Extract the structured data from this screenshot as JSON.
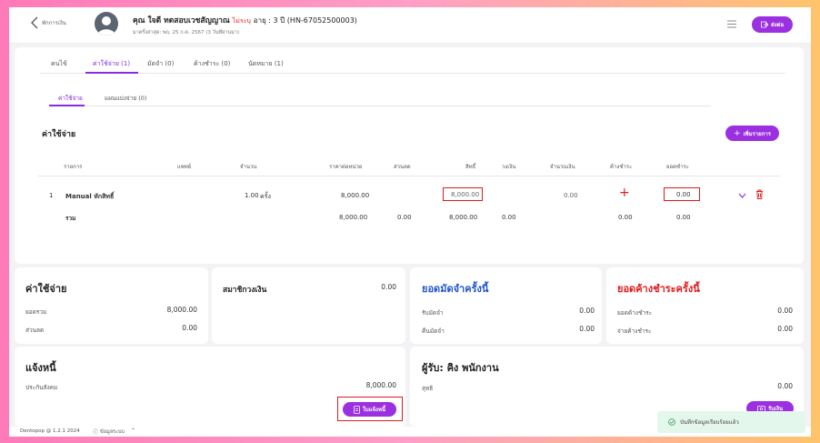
{
  "header": {
    "back_label": "พักการเงิน",
    "patient_name": "คุณ ใจดี ทดสอบเวชสัญญาณ",
    "patient_tag": "ไม่ระบุ",
    "age_text": "อายุ : 3 ปี (HN-67052500003)",
    "last_visit": "มาครั้งล่าสุด: พฤ. 25 ก.ค. 2567 (3 วันที่ผ่านมา)",
    "send_button": "ส่งต่อ"
  },
  "main_tabs": [
    {
      "label": "คนไข้"
    },
    {
      "label": "ค่าใช้จ่าย (1)"
    },
    {
      "label": "มัดจำ (0)"
    },
    {
      "label": "ค้างชำระ (0)"
    },
    {
      "label": "นัดหมาย (1)"
    }
  ],
  "sub_tabs": [
    {
      "label": "ค่าใช้จ่าย"
    },
    {
      "label": "แผนแบ่งจ่าย (0)"
    }
  ],
  "expense": {
    "title": "ค่าใช้จ่าย",
    "add_button": "เพิ่มรายการ",
    "columns": [
      "รายการ",
      "แพทย์",
      "จำนวน",
      "ราคาต่อหน่วย",
      "ส่วนลด",
      "สิทธิ์",
      "วงเงิน",
      "จำนวนเงิน",
      "ค้างชำระ",
      "ยอดชำระ"
    ],
    "row": {
      "index": "1",
      "item": "Manual หักสิทธิ์",
      "qty": "1.00",
      "unit": "ครั้ง",
      "unit_price": "8,000.00",
      "privilege": "8,000.00",
      "amount": "0.00",
      "paid": "0.00"
    },
    "total": {
      "label": "รวม",
      "unit_price": "8,000.00",
      "discount": "0.00",
      "privilege": "8,000.00",
      "limit": "0.00",
      "outstanding": "0.00",
      "paid": "0.00"
    }
  },
  "summary": {
    "expense_title": "ค่าใช้จ่าย",
    "total_label": "ยอดรวม",
    "total_value": "8,000.00",
    "discount_label": "ส่วนลด",
    "discount_value": "0.00",
    "member_title": "สมาชิกวงเงิน",
    "member_value": "0.00",
    "deposit_title": "ยอดมัดจำครั้งนี้",
    "deposit_receive_label": "รับมัดจำ",
    "deposit_receive_value": "0.00",
    "deposit_return_label": "คืนมัดจำ",
    "deposit_return_value": "0.00",
    "outstanding_title": "ยอดค้างชำระครั้งนี้",
    "outstanding_label": "ยอดค้างชำระ",
    "outstanding_value": "0.00",
    "pay_outstanding_label": "จ่ายค้างชำระ",
    "pay_outstanding_value": "0.00"
  },
  "notify": {
    "title": "แจ้งหนี้",
    "claim_label": "ประกันสังคม",
    "claim_value": "8,000.00",
    "invoice_button": "ใบแจ้งหนี้"
  },
  "receiver": {
    "title": "ผู้รับ: คิง พนักงาน",
    "net_label": "สุทธิ",
    "net_value": "0.00",
    "receive_button": "รับเงิน"
  },
  "footer": {
    "version": "Dentopop @ 1.2.1 2024",
    "system_info": "ข้อมูลระบบ"
  },
  "toast": {
    "message": "บันทึกข้อมูลเรียบร้อยแล้ว"
  },
  "colors": {
    "accent": "#9b30e0",
    "danger": "#e01a1a",
    "info": "#2255cc"
  }
}
